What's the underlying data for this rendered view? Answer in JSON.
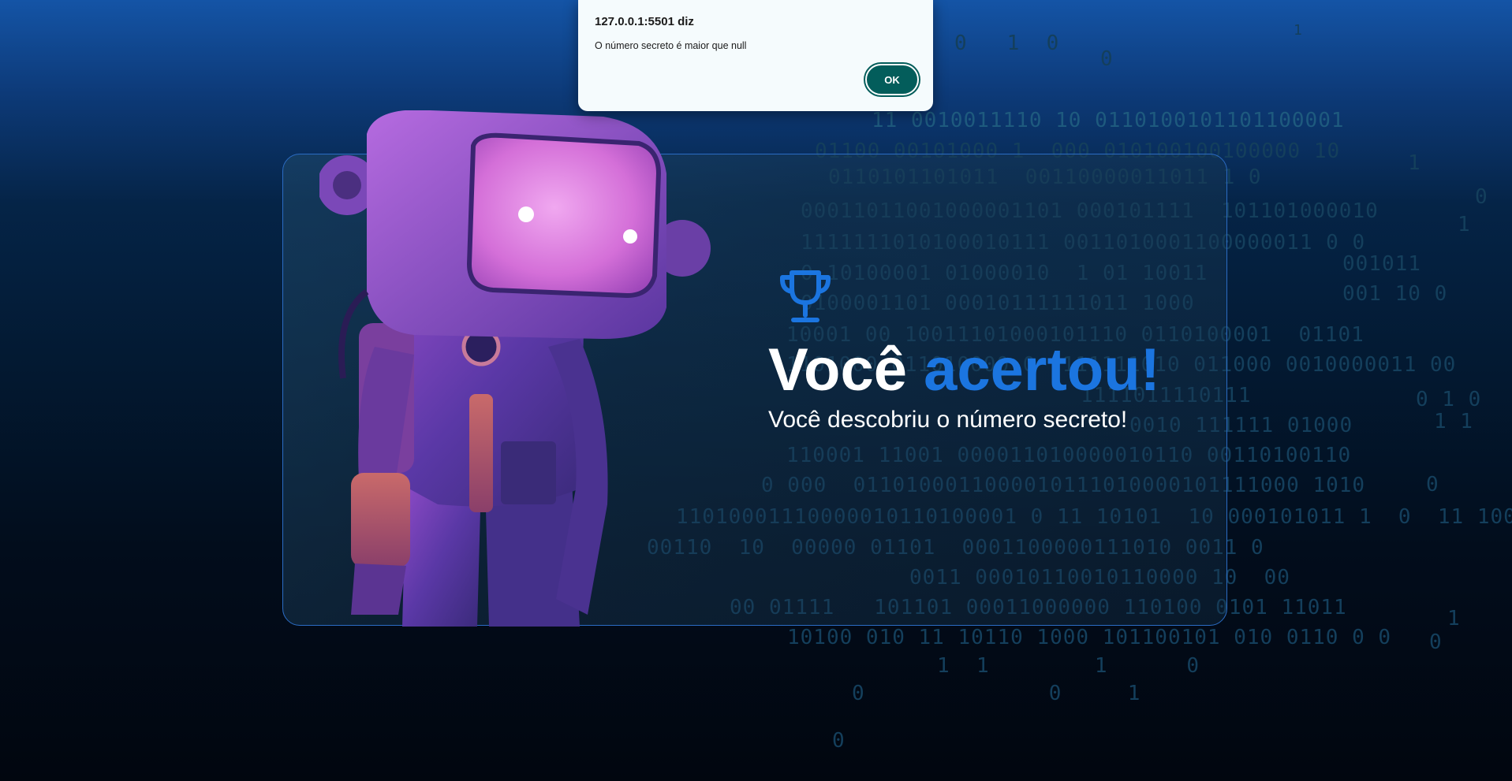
{
  "alert": {
    "title": "127.0.0.1:5501 diz",
    "message": "O número secreto é maior que null",
    "ok_label": "OK"
  },
  "result": {
    "title_part1": "Você ",
    "title_part2": "acertou!",
    "subtitle": "Você descobriu o número secreto!"
  },
  "icons": {
    "trophy": "trophy-icon"
  },
  "colors": {
    "accent": "#1b75e0",
    "ok_button": "#035d5b",
    "card_border": "#2b6cc4"
  },
  "background_binary": [
    "0   1  0",
    "0",
    "1",
    "11 0010011110 10 0110100101101100001",
    "01100 00101000 1  000 010100100100000 10",
    "0110101101011  00110000011011 1 0",
    "00011011001000001101 000101111  101101000010",
    "1111111010100010111 0011010001100000011 0 0",
    "0 10100001 01000010  1 01 10011",
    "0100001101 00010111111011 1000",
    "10001 00 10011101000101110 0110100001  01101",
    "1101000 011010000 0  111111010 011000 0010000011 00",
    "1111011110111",
    "0010 111111 01000",
    "110001 11001 000011010000010110 00110100110",
    "0 000  0110100011000010111010000101111000 1010",
    "11010001110000010110100001 0 11 10101  10 000101011 1  0  11 100",
    "00110  10  00000 01101  0001100000111010 0011 0",
    "0011 00010110010110000 10  00",
    "00 01111   101101 00011000000 110100 0101 11011",
    "10100 010 11 10110 1000 101100101 010 0110 0 0",
    "1  1        1      0",
    "0              0     1",
    "0",
    "001011",
    "001 10 0",
    "0 1 0",
    "1 1",
    "1",
    "0",
    "1",
    "0",
    "1",
    "0"
  ]
}
